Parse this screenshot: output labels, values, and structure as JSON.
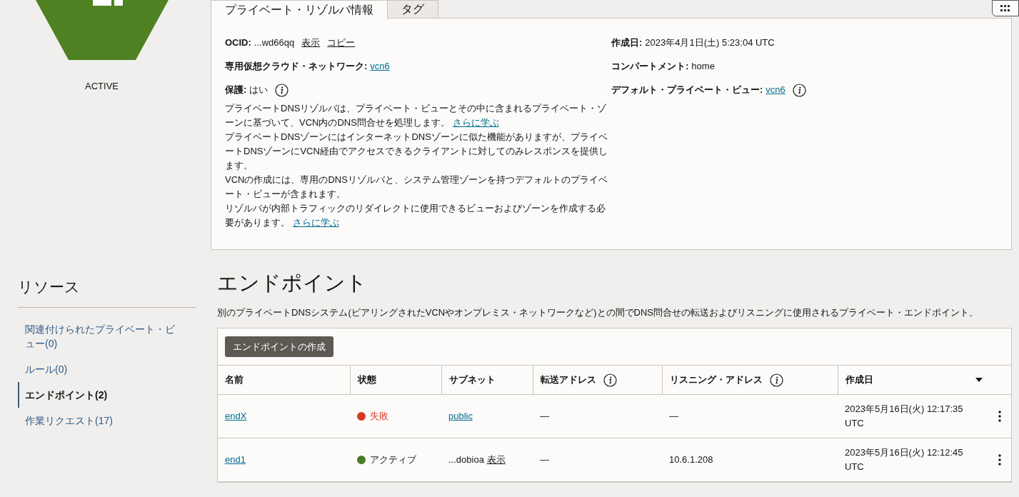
{
  "resource": {
    "status": "ACTIVE"
  },
  "tabs": [
    {
      "label": "プライベート・リゾルバ情報",
      "selected": true
    },
    {
      "label": "タグ",
      "selected": false
    }
  ],
  "details_left": [
    {
      "label": "OCID:",
      "value": "...wd66qq",
      "links": [
        "表示",
        "コピー"
      ],
      "info": false
    },
    {
      "label": "専用仮想クラウド・ネットワーク:",
      "link_value": "vcn6",
      "info": false
    },
    {
      "label": "保護:",
      "value": "はい",
      "info": true
    }
  ],
  "details_right": [
    {
      "label": "作成日:",
      "value": "2023年4月1日(土) 5:23:04 UTC",
      "info": false
    },
    {
      "label": "コンパートメント:",
      "value": "home",
      "info": false
    },
    {
      "label": "デフォルト・プライベート・ビュー:",
      "link_value": "vcn6",
      "info": true
    }
  ],
  "description": [
    {
      "text": "プライベートDNSリゾルバは、プライベート・ビューとその中に含まれるプライベート・ゾーンに基づいて、VCN内のDNS問合せを処理します。",
      "link": "さらに学ぶ"
    },
    {
      "text": "プライベートDNSゾーンにはインターネットDNSゾーンに似た機能がありますが、プライベートDNSゾーンにVCN経由でアクセスできるクライアントに対してのみレスポンスを提供します。"
    },
    {
      "text": "VCNの作成には、専用のDNSリゾルバと、システム管理ゾーンを持つデフォルトのプライベート・ビューが含まれます。"
    },
    {
      "text": "リゾルバが内部トラフィックのリダイレクトに使用できるビューおよびゾーンを作成する必要があります。",
      "link": "さらに学ぶ"
    }
  ],
  "sidebar": {
    "title": "リソース",
    "items": [
      {
        "label": "関連付けられたプライベート・ビュー(0)",
        "selected": false
      },
      {
        "label": "ルール(0)",
        "selected": false
      },
      {
        "label": "エンドポイント(2)",
        "selected": true
      },
      {
        "label": "作業リクエスト(17)",
        "selected": false
      }
    ]
  },
  "section": {
    "title": "エンドポイント",
    "description": "別のプライベートDNSシステム(ピアリングされたVCNやオンプレミス・ネットワークなど)との間でDNS問合せの転送およびリスニングに使用されるプライベート・エンドポイント。",
    "create_button": "エンドポイントの作成"
  },
  "table": {
    "columns": [
      {
        "label": "名前",
        "info": false,
        "sort": false
      },
      {
        "label": "状態",
        "info": false,
        "sort": false
      },
      {
        "label": "サブネット",
        "info": false,
        "sort": false
      },
      {
        "label": "転送アドレス",
        "info": true,
        "sort": false
      },
      {
        "label": "リスニング・アドレス",
        "info": true,
        "sort": false
      },
      {
        "label": "作成日",
        "info": false,
        "sort": true
      }
    ],
    "rows": [
      {
        "name": "endX",
        "state": "失敗",
        "color": "#d63b25",
        "subnet": {
          "kind": "link",
          "text": "public"
        },
        "forwarding": "—",
        "listening": "—",
        "created": "2023年5月16日(火) 12:17:35 UTC"
      },
      {
        "name": "end1",
        "state": "アクティブ",
        "color": "#4a7c28",
        "subnet": {
          "kind": "masked",
          "text": "...dobioa",
          "action": "表示"
        },
        "forwarding": "—",
        "listening": "10.6.1.208",
        "created": "2023年5月16日(火) 12:12:45 UTC"
      }
    ]
  }
}
